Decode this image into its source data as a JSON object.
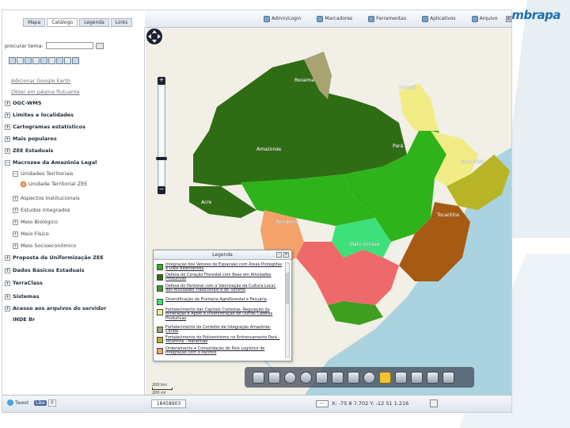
{
  "tabs": [
    "Mapa",
    "Catálogo",
    "Legenda",
    "Links"
  ],
  "toolbar": {
    "items": [
      "Admin/Login",
      "Marcadores",
      "Ferramentas",
      "Aplicativos",
      "Arquivo"
    ],
    "close": "x"
  },
  "left_panel": {
    "search_label": "procurar tema:",
    "tree": [
      {
        "label": "Adicionar Google Earth",
        "style": "link"
      },
      {
        "label": "Obter em página flutuante",
        "style": "link"
      },
      {
        "label": "OGC-WMS",
        "style": "bold"
      },
      {
        "label": "Limites e localidades",
        "style": "bold"
      },
      {
        "label": "Cartogramas estatísticos",
        "style": "bold"
      },
      {
        "label": "Mais populares",
        "style": "bold"
      },
      {
        "label": "ZEE Estaduais",
        "style": "bold"
      },
      {
        "label": "Macrozee da Amazônia Legal",
        "style": "bold"
      },
      {
        "label": "Unidades Territoriais",
        "style": "sub"
      },
      {
        "label": "Unidade Territorial ZEE",
        "style": "sub"
      },
      {
        "label": "Aspectos Institucionais",
        "style": "sub"
      },
      {
        "label": "Estudos Integrados",
        "style": "sub"
      },
      {
        "label": "Meio Biológico",
        "style": "sub"
      },
      {
        "label": "Meio Físico",
        "style": "sub"
      },
      {
        "label": "Meio Socioeconômico",
        "style": "sub"
      },
      {
        "label": "Proposta de Uniformização ZEE",
        "style": "bold"
      },
      {
        "label": "Dados Básicos Estaduais",
        "style": "bold"
      },
      {
        "label": "TerraClass",
        "style": "bold"
      },
      {
        "label": "Sistemas",
        "style": "bold"
      },
      {
        "label": "Acesso aos arquivos do servidor",
        "style": "bold"
      },
      {
        "label": "INDE Br",
        "style": "bold"
      }
    ]
  },
  "map": {
    "labels": [
      "Roraima",
      "Amapá",
      "Amazonas",
      "Pará",
      "Maranhão",
      "Acre",
      "Rondônia",
      "Tocantins",
      "Mato Grosso"
    ],
    "colors": {
      "ocean": "#aad3df",
      "land": "#f2efe6",
      "dark_green": "#2f6d14",
      "green": "#2fb31a",
      "light_green": "#3ee07a",
      "yellow": "#f2ec86",
      "olive": "#b7b527",
      "tan": "#a7a372",
      "brown": "#a65a12",
      "orange": "#f4a16a",
      "red": "#ee6a6a",
      "mid_green": "#3d9e1f"
    }
  },
  "legend": {
    "title": "Legenda",
    "items": [
      {
        "text": "Integração dos Vetores de Expansão com Áreas Protegidas e Usos Alternativos",
        "color": "#2fb31a"
      },
      {
        "text": "Defesa do Coração Florestal com Base em Atividades Produtivas",
        "color": "#2f6d14"
      },
      {
        "text": "Defesa do Pantanal com a Valorização da Cultura Local, das Atividades Tradicionais e do Turismo",
        "color": "#3d9e1f"
      },
      {
        "text": "Diversificação da Fronteira Agroflorestal e Pecuária",
        "color": "#3ee07a"
      },
      {
        "text": "Fortalecimento das Capitais Costeiras, Regulação da Mineração e Apoio à Diversificação de Outras Cadeias Produtivas",
        "color": "#f2ec86"
      },
      {
        "text": "Fortalecimento do Corredor de Integração Amazônia-Caribe",
        "color": "#a7a372"
      },
      {
        "text": "Fortalecimento do Policentrismo no Entroncamento Pará - Tocantins - Maranhão",
        "color": "#b7b527"
      },
      {
        "text": "Ordenamento e Consolidação do Polo Logístico de Integração com o Pacífico",
        "color": "#f4a16a"
      }
    ]
  },
  "scale_bar": [
    "200 km",
    "200 mi"
  ],
  "statusbar": {
    "tweet": "Tweet",
    "like": "Like",
    "like_count": "0",
    "scale_value": "18458903",
    "select_value": "---",
    "coords": "X: -75  8  7.702  Y: -12  51  1.216"
  },
  "logo": "Embrapa"
}
